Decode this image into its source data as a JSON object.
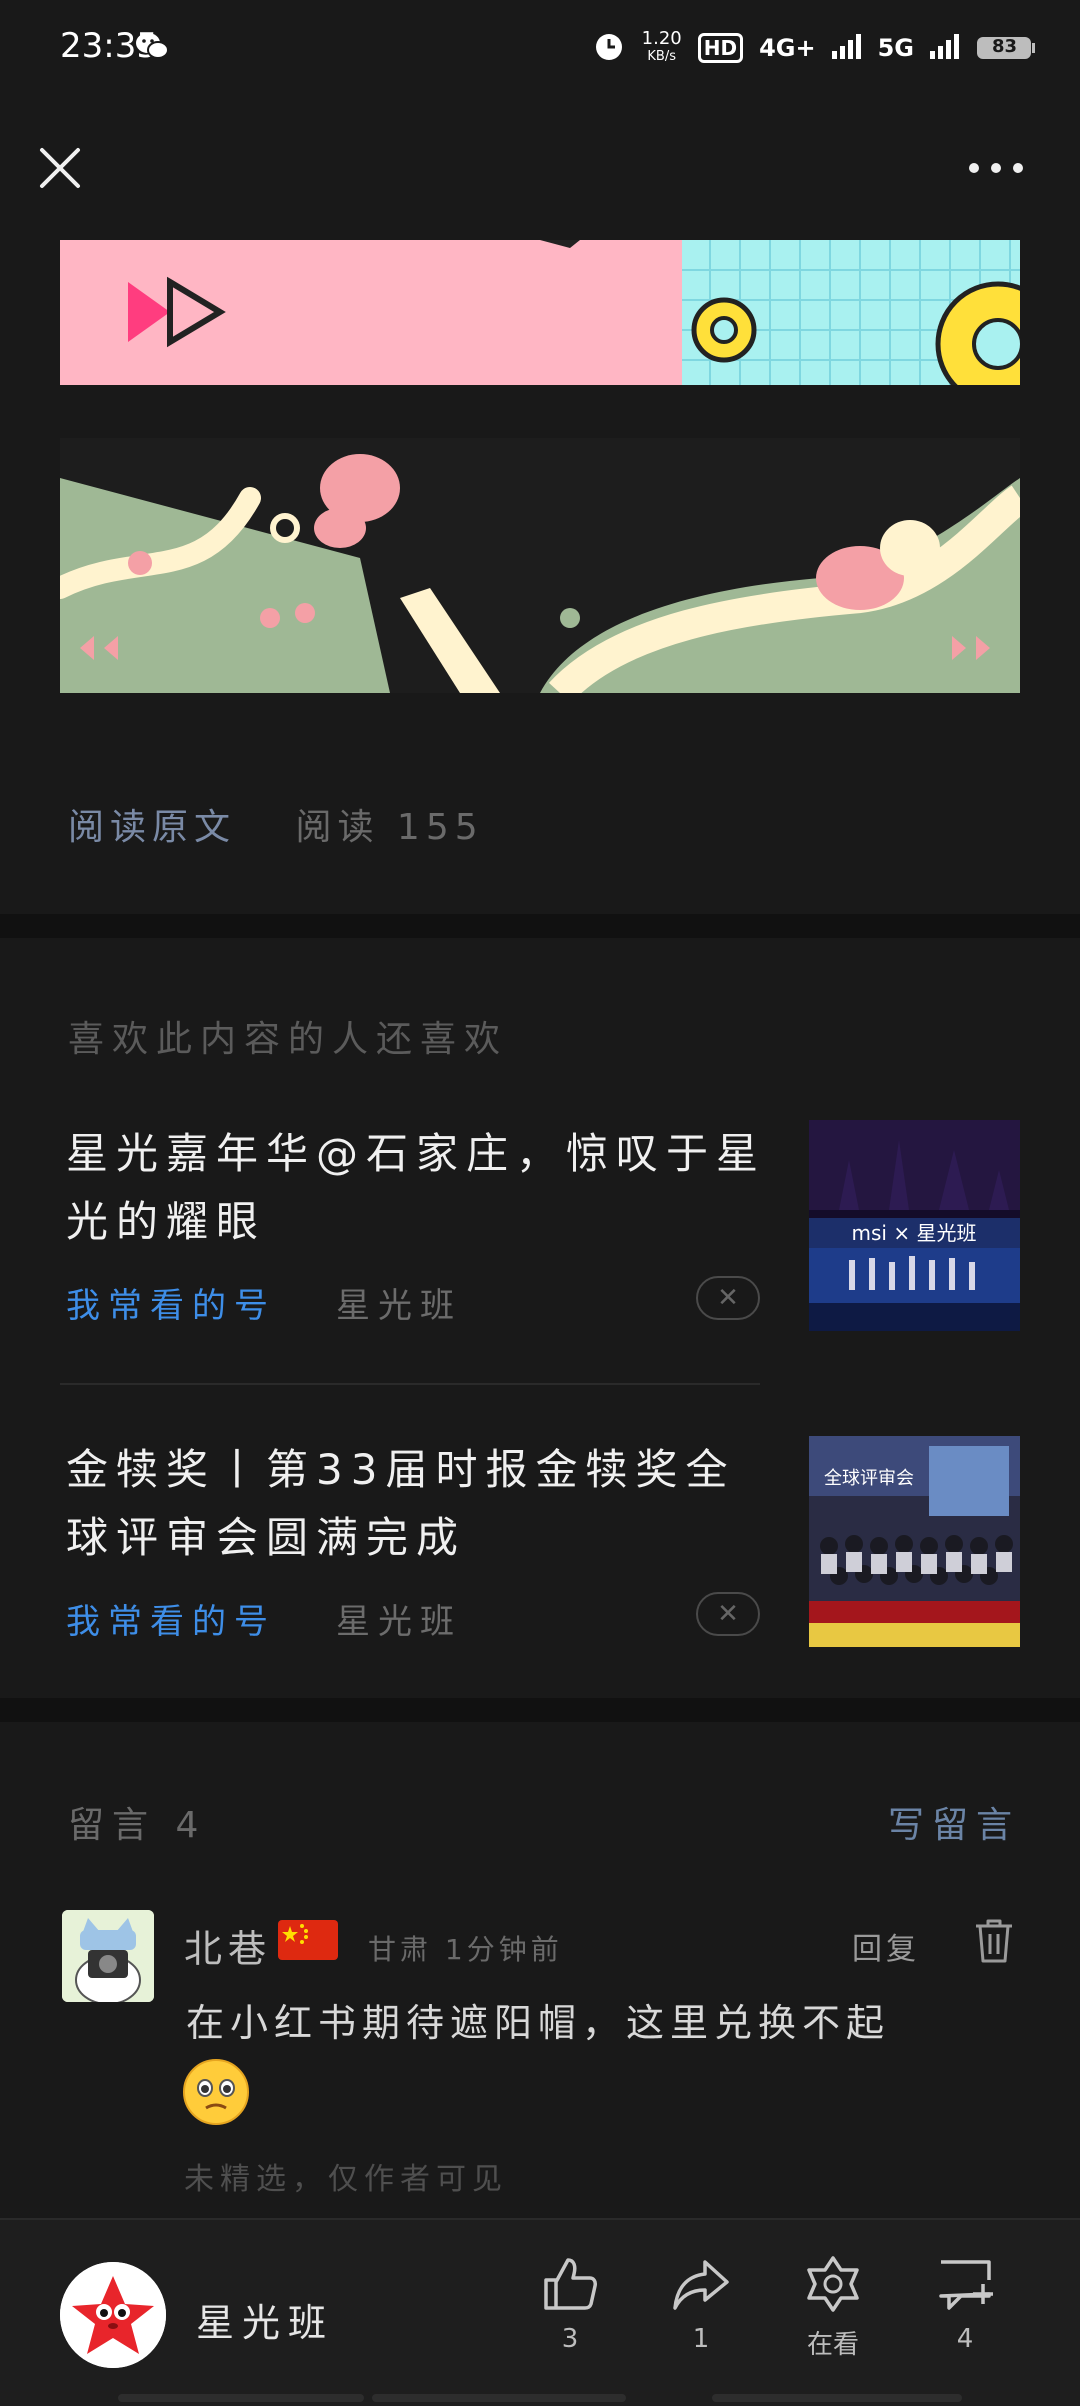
{
  "status_bar": {
    "time": "23:35",
    "speed_value": "1.20",
    "speed_unit": "KB/s",
    "hd": "HD",
    "net1": "4G+",
    "net2": "5G",
    "battery": "83"
  },
  "article": {
    "read_original": "阅读原文",
    "reads": "阅读 155"
  },
  "recommend": {
    "title": "喜欢此内容的人还喜欢",
    "items": [
      {
        "title": "星光嘉年华@石家庄，惊叹于星光的耀眼",
        "tag": "我常看的号",
        "source": "星光班",
        "thumb_text": "msi × 星光班"
      },
      {
        "title": "金犊奖丨第33届时报金犊奖全球评审会圆满完成",
        "tag": "我常看的号",
        "source": "星光班",
        "thumb_text": "全球评审会"
      }
    ]
  },
  "comments": {
    "title": "留言 4",
    "write": "写留言",
    "items": [
      {
        "name": "北巷",
        "meta": "甘肃 1分钟前",
        "reply": "回复",
        "text": "在小红书期待遮阳帽，这里兑换不起",
        "note": "未精选，仅作者可见"
      }
    ]
  },
  "bottom_bar": {
    "account": "星光班",
    "like_count": "3",
    "share_count": "1",
    "wow_label": "在看",
    "comment_count": "4"
  }
}
